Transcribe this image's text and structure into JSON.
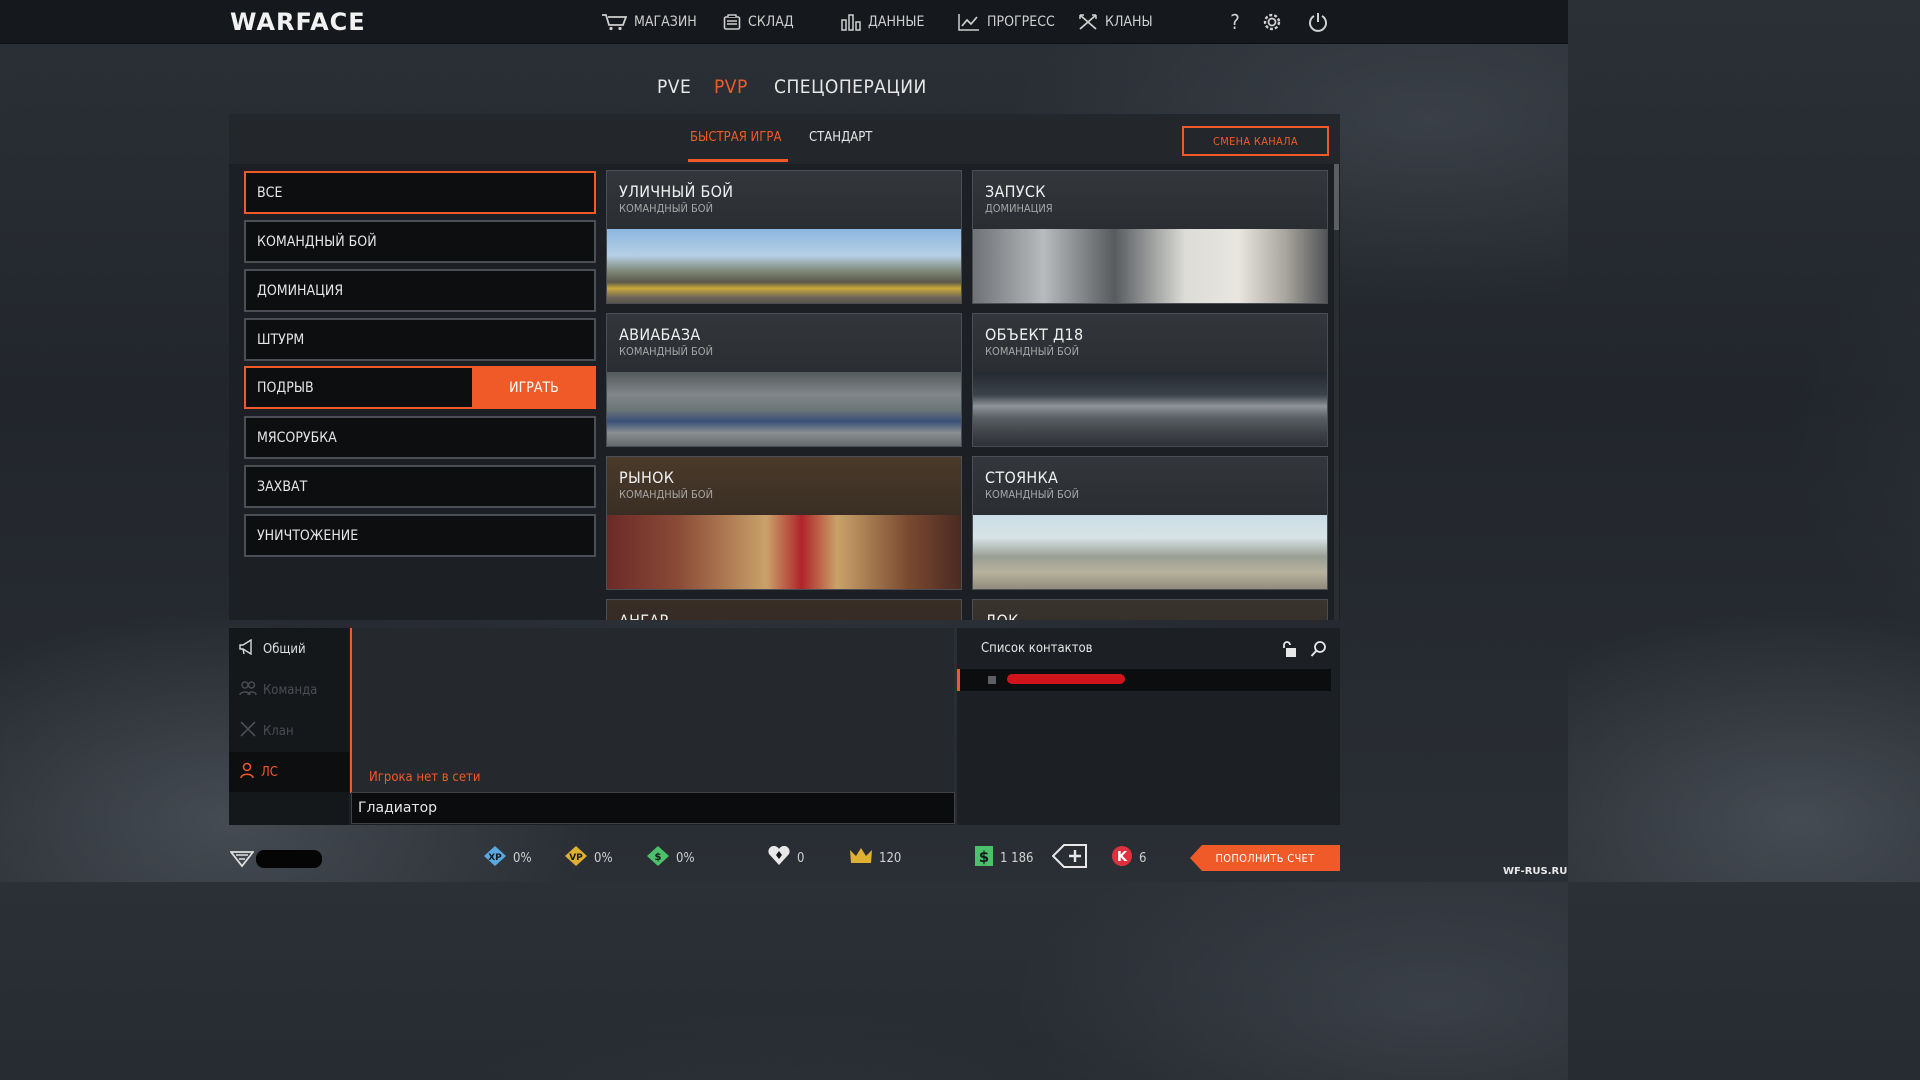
{
  "brand": {
    "logo": "WARFACE"
  },
  "nav": [
    {
      "label": "МАГАЗИН",
      "icon": "cart-icon"
    },
    {
      "label": "СКЛАД",
      "icon": "storage-icon"
    },
    {
      "label": "ДАННЫЕ",
      "icon": "stats-icon"
    },
    {
      "label": "ПРОГРЕСС",
      "icon": "progress-icon"
    },
    {
      "label": "КЛАНЫ",
      "icon": "clans-icon"
    }
  ],
  "mode_tabs": [
    {
      "label": "PVE",
      "active": false
    },
    {
      "label": "PVP",
      "active": true
    },
    {
      "label": "СПЕЦОПЕРАЦИИ",
      "active": false
    }
  ],
  "sub_tabs": [
    {
      "label": "БЫСТРАЯ ИГРА",
      "active": true
    },
    {
      "label": "СТАНДАРТ",
      "active": false
    }
  ],
  "channel_button": "СМЕНА КАНАЛА",
  "game_modes": [
    {
      "label": "ВСЕ",
      "selected": true
    },
    {
      "label": "КОМАНДНЫЙ БОЙ",
      "selected": false
    },
    {
      "label": "ДОМИНАЦИЯ",
      "selected": false
    },
    {
      "label": "ШТУРМ",
      "selected": false
    },
    {
      "label": "ПОДРЫВ",
      "selected": true
    },
    {
      "label": "МЯСОРУБКА",
      "selected": false
    },
    {
      "label": "ЗАХВАТ",
      "selected": false
    },
    {
      "label": "УНИЧТОЖЕНИЕ",
      "selected": false
    }
  ],
  "play_button": "ИГРАТЬ",
  "maps": [
    {
      "name": "УЛИЧНЫЙ БОЙ",
      "mode": "КОМАНДНЫЙ БОЙ"
    },
    {
      "name": "ЗАПУСК",
      "mode": "ДОМИНАЦИЯ"
    },
    {
      "name": "АВИАБАЗА",
      "mode": "КОМАНДНЫЙ БОЙ"
    },
    {
      "name": "ОБЪЕКТ Д18",
      "mode": "КОМАНДНЫЙ БОЙ"
    },
    {
      "name": "РЫНОК",
      "mode": "КОМАНДНЫЙ БОЙ"
    },
    {
      "name": "СТОЯНКА",
      "mode": "КОМАНДНЫЙ БОЙ"
    },
    {
      "name": "АНГАР",
      "mode": ""
    },
    {
      "name": "ДОК",
      "mode": ""
    }
  ],
  "chat": {
    "tabs": [
      {
        "label": "Общий",
        "state": "normal",
        "icon": "megaphone-icon"
      },
      {
        "label": "Команда",
        "state": "disabled",
        "icon": "team-icon"
      },
      {
        "label": "Клан",
        "state": "disabled",
        "icon": "clan-icon"
      },
      {
        "label": "ЛС",
        "state": "active",
        "icon": "person-icon"
      }
    ],
    "status": "Игрока нет в сети",
    "input_value": "Гладиатор"
  },
  "contacts": {
    "title": "Список контактов"
  },
  "status_bar": [
    {
      "icon": "booster-xp-icon",
      "value": "0%",
      "color": "#5aa8e0"
    },
    {
      "icon": "booster-vp-icon",
      "value": "0%",
      "color": "#e0b030"
    },
    {
      "icon": "booster-money-icon",
      "value": "0%",
      "color": "#4cc06a"
    },
    {
      "icon": "heart-icon",
      "value": "0",
      "color": "#e8e8e8"
    },
    {
      "icon": "crown-icon",
      "value": "120",
      "color": "#e0b030"
    },
    {
      "icon": "money-icon",
      "value": "1 186",
      "color": "#4cc06a"
    },
    {
      "icon": "add-icon",
      "value": "",
      "color": "#e8e8e8"
    },
    {
      "icon": "kredits-icon",
      "value": "6",
      "color": "#e03040"
    }
  ],
  "topup_button": "ПОПОЛНИТЬ СЧЕТ",
  "watermark": "WF-RUS.RU",
  "accent_color": "#f05a28"
}
